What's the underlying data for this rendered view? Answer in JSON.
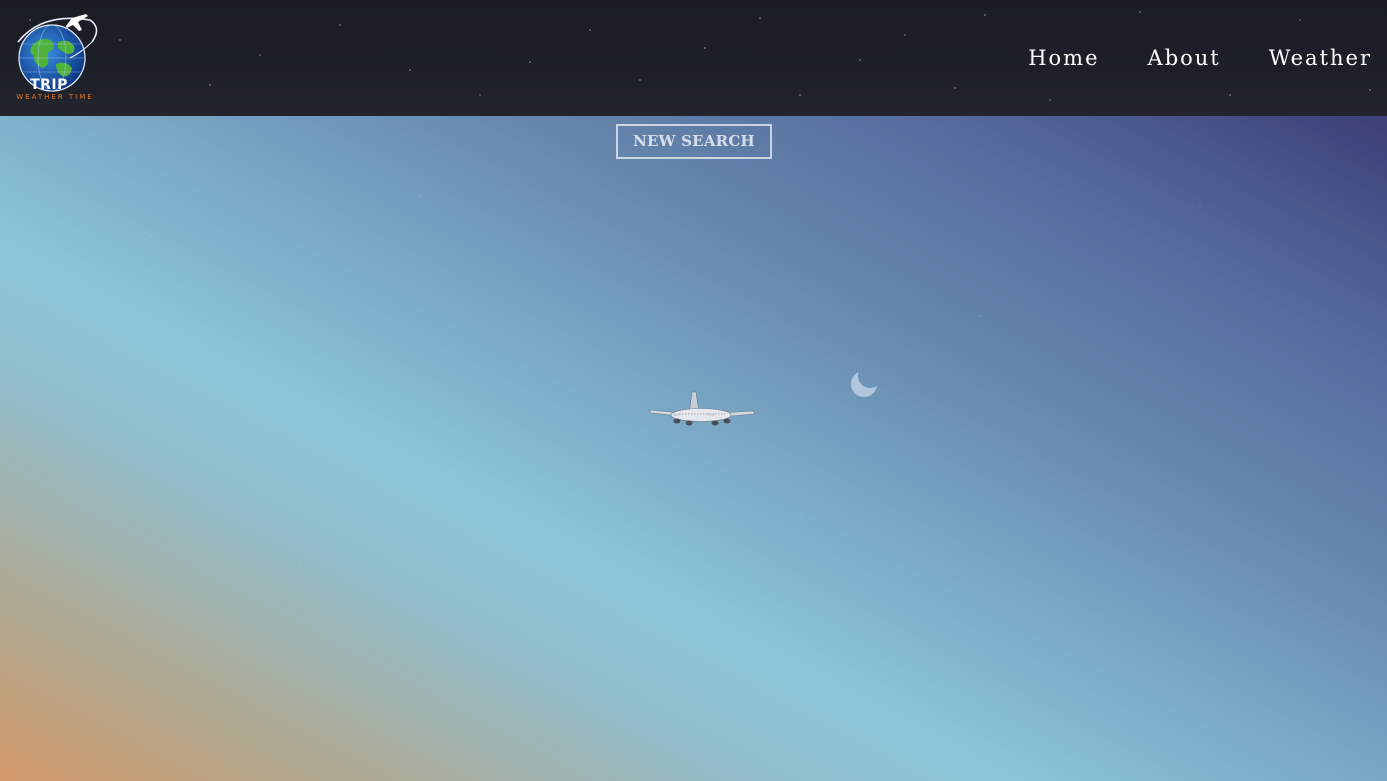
{
  "logo": {
    "title": "TRIP",
    "subtitle": "WEATHER TIME",
    "icon": "globe-airplane-icon"
  },
  "nav": {
    "items": [
      {
        "label": "Home"
      },
      {
        "label": "About"
      },
      {
        "label": "Weather"
      }
    ]
  },
  "main": {
    "new_search_label": "NEW SEARCH",
    "decor": {
      "airplane": "airplane-icon",
      "moon": "crescent-moon-icon"
    }
  },
  "colors": {
    "header_bg": "#1d2028",
    "nav_text": "#ffffff",
    "logo_subtitle": "#e07a2a",
    "sky_top_right": "#3d3f75",
    "sky_middle": "#8ac6da",
    "sky_bottom_left": "#d49a6a"
  }
}
